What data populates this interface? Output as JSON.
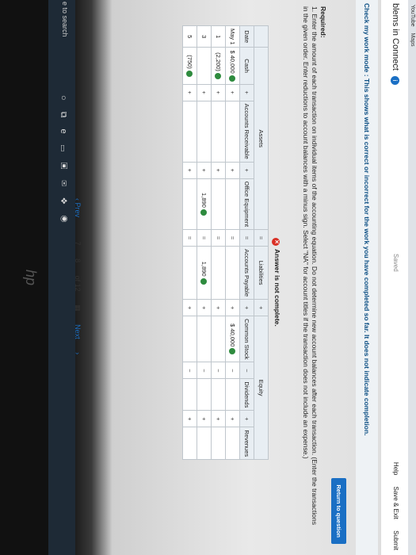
{
  "browser": {
    "bookmarks": [
      "YouTube",
      "Maps"
    ]
  },
  "app": {
    "title": "blems in Connect",
    "info_icon": "info-icon",
    "saved": "Saved",
    "help": "Help",
    "save_exit": "Save & Exit",
    "submit": "Submit"
  },
  "banner": "Check my work mode : This shows what is correct or incorrect for the work you have completed so far. It does not indicate completion.",
  "return_button": "Return to question",
  "required": {
    "heading": "Required:",
    "text": "1. Enter the amount of each transaction on individual items of the accounting equation. Do not determine new account balances after each transaction. (Enter the transactions in the given order. Enter reductions to account balances with a minus sign. Select \"NA\" for account titles if the transaction does not include an expense.)"
  },
  "answer_status": "Answer is not complete.",
  "table": {
    "group_assets": "Assets",
    "group_liabilities": "Liabilities",
    "group_equity": "Equity",
    "headers": [
      "Date",
      "Cash",
      "Accounts Receivable",
      "Office Equipment",
      "Accounts Payable",
      "Common Stock",
      "Dividends",
      "Revenues"
    ],
    "ops": {
      "plus": "+",
      "equals": "=",
      "minus": "−"
    },
    "rows": [
      {
        "month": "May",
        "day": "1",
        "cash": "$ 40,000",
        "ar": "",
        "oe": "",
        "ap": "",
        "cs": "$ 40,000",
        "div": "",
        "rev": ""
      },
      {
        "month": "",
        "day": "1",
        "cash": "(2,200)",
        "ar": "",
        "oe": "",
        "ap": "",
        "cs": "",
        "div": "",
        "rev": ""
      },
      {
        "month": "",
        "day": "3",
        "cash": "",
        "ar": "",
        "oe": "1,890",
        "ap": "1,890",
        "cs": "",
        "div": "",
        "rev": ""
      },
      {
        "month": "",
        "day": "5",
        "cash": "(750)",
        "ar": "",
        "oe": "",
        "ap": "",
        "cs": "",
        "div": "",
        "rev": ""
      }
    ]
  },
  "pager": {
    "prev": "Prev",
    "current": "7",
    "next_page": "8",
    "of": "of 12",
    "next": "Next"
  },
  "taskbar": {
    "search": "e to search"
  },
  "device_logo": "hp"
}
